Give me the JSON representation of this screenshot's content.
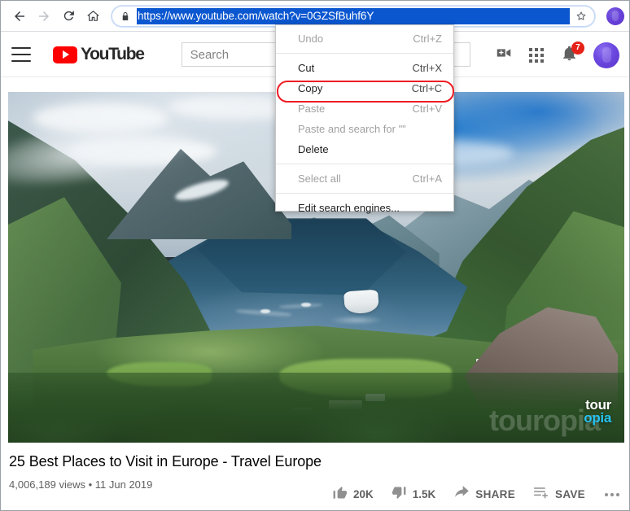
{
  "browser": {
    "back_icon": "back-arrow-icon",
    "forward_icon": "forward-arrow-icon",
    "reload_icon": "reload-icon",
    "home_icon": "home-icon",
    "lock_icon": "padlock-icon",
    "url": "https://www.youtube.com/watch?v=0GZSfBuhf6Y",
    "url_selected": true,
    "bookmark_icon": "star-icon",
    "profile_icon": "profile-avatar-icon"
  },
  "youtube_header": {
    "menu_icon": "hamburger-menu-icon",
    "logo_text": "YouTube",
    "logo_icon": "youtube-play-icon",
    "search_placeholder": "Search",
    "search_value": "",
    "create_icon": "create-video-icon",
    "apps_icon": "apps-grid-icon",
    "notifications_icon": "notification-bell-icon",
    "notifications_count": "7",
    "avatar_icon": "account-avatar-icon"
  },
  "video": {
    "title": "25 Best Places to Visit in Europe - Travel Europe",
    "views": "4,006,189 views",
    "separator": "•",
    "date": "11 Jun 2019",
    "watermark_line1": "tour",
    "watermark_line2": "opia",
    "watermark_ghost": "touropia",
    "actions": [
      {
        "icon": "thumbs-up-icon",
        "label": "20K",
        "name": "like-button"
      },
      {
        "icon": "thumbs-down-icon",
        "label": "1.5K",
        "name": "dislike-button"
      },
      {
        "icon": "share-icon",
        "label": "SHARE",
        "name": "share-button"
      },
      {
        "icon": "save-playlist-icon",
        "label": "SAVE",
        "name": "save-button"
      },
      {
        "icon": "more-actions-icon",
        "label": "",
        "name": "more-button"
      }
    ]
  },
  "context_menu": {
    "items": [
      {
        "label": "Undo",
        "accel": "Ctrl+Z",
        "disabled": true
      },
      {
        "label": "Cut",
        "accel": "Ctrl+X",
        "disabled": false
      },
      {
        "label": "Copy",
        "accel": "Ctrl+C",
        "disabled": false
      },
      {
        "label": "Paste",
        "accel": "Ctrl+V",
        "disabled": true
      },
      {
        "label": "Paste and search for \"\"",
        "accel": "",
        "disabled": true
      },
      {
        "label": "Delete",
        "accel": "",
        "disabled": false
      },
      {
        "label": "Select all",
        "accel": "Ctrl+A",
        "disabled": true
      },
      {
        "label": "Edit search engines...",
        "accel": "",
        "disabled": false
      }
    ],
    "highlight_item": "Copy",
    "highlight_color": "#ee1c25"
  },
  "colors": {
    "youtube_red": "#ff0000",
    "badge_red": "#e62117",
    "selection_blue": "#0b57d0",
    "highlight_red": "#ee1c25",
    "avatar_purple": "#5b34c9"
  }
}
